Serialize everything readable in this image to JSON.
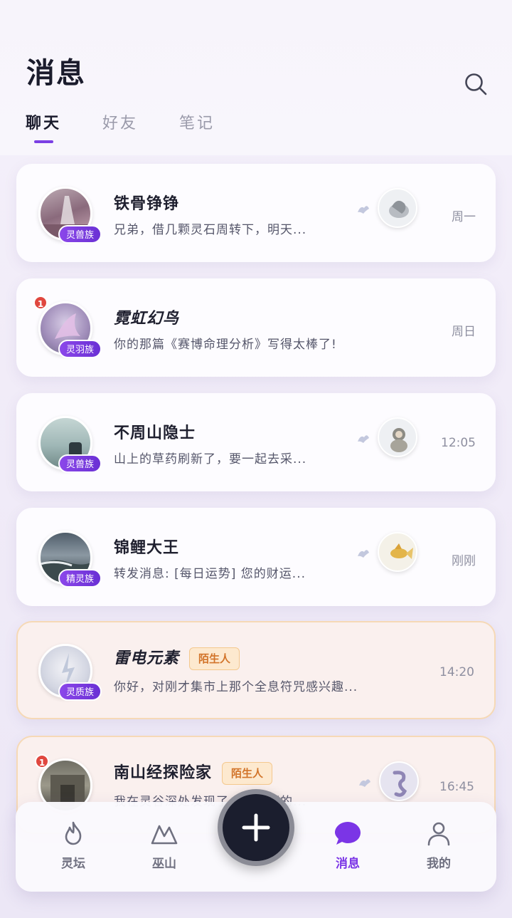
{
  "header": {
    "title": "消息"
  },
  "tabs": [
    {
      "label": "聊天",
      "active": true
    },
    {
      "label": "好友",
      "active": false
    },
    {
      "label": "笔记",
      "active": false
    }
  ],
  "conversations": [
    {
      "name": "铁骨铮铮",
      "tribe": "灵兽族",
      "preview": "兄弟，借几颗灵石周转下，明天...",
      "time": "周一",
      "unread": null,
      "stranger": false,
      "italic": false,
      "has_thumb": true
    },
    {
      "name": "霓虹幻鸟",
      "tribe": "灵羽族",
      "preview": "你的那篇《赛博命理分析》写得太棒了!",
      "time": "周日",
      "unread": "1",
      "stranger": false,
      "italic": true,
      "has_thumb": false
    },
    {
      "name": "不周山隐士",
      "tribe": "灵兽族",
      "preview": "山上的草药刷新了，要一起去采...",
      "time": "12:05",
      "unread": null,
      "stranger": false,
      "italic": false,
      "has_thumb": true
    },
    {
      "name": "锦鲤大王",
      "tribe": "精灵族",
      "preview": "转发消息: [每日运势] 您的财运...",
      "time": "刚刚",
      "unread": null,
      "stranger": false,
      "italic": false,
      "has_thumb": true
    },
    {
      "name": "雷电元素",
      "tribe": "灵质族",
      "preview": "你好，对刚才集市上那个全息符咒感兴趣...",
      "time": "14:20",
      "unread": null,
      "stranger": true,
      "stranger_label": "陌生人",
      "italic": true,
      "has_thumb": false
    },
    {
      "name": "南山经探险家",
      "tribe": "",
      "preview": "我在灵谷深处发现了一个隐藏的...",
      "time": "16:45",
      "unread": "1",
      "stranger": true,
      "stranger_label": "陌生人",
      "italic": false,
      "has_thumb": true
    }
  ],
  "nav": {
    "items": [
      {
        "label": "灵坛",
        "icon": "flame-icon",
        "active": false
      },
      {
        "label": "巫山",
        "icon": "mountain-icon",
        "active": false
      },
      {
        "label": "消息",
        "icon": "chat-bubble-icon",
        "active": true
      },
      {
        "label": "我的",
        "icon": "person-icon",
        "active": false
      }
    ],
    "fab_icon": "plus-icon"
  },
  "colors": {
    "accent": "#7b35e6",
    "stranger_tag": "#d2742a",
    "unread_badge": "#e0473f"
  }
}
